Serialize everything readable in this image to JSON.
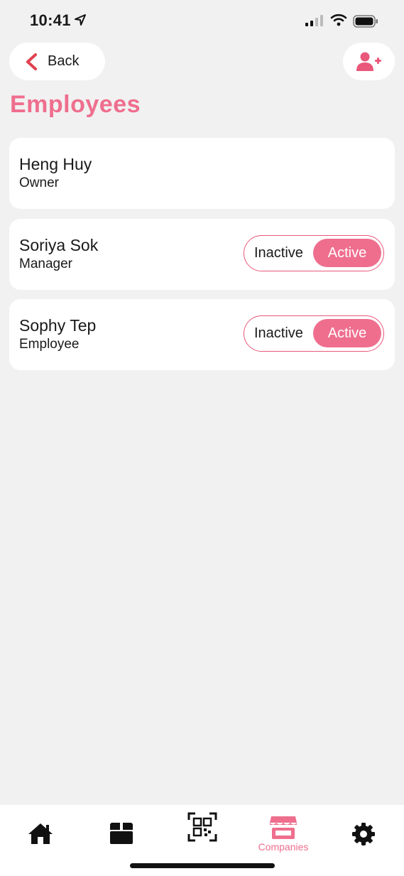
{
  "status_bar": {
    "time": "10:41"
  },
  "header": {
    "back_label": "Back",
    "title": "Employees"
  },
  "employees": [
    {
      "name": "Heng Huy",
      "role": "Owner",
      "show_toggle": false
    },
    {
      "name": "Soriya Sok",
      "role": "Manager",
      "show_toggle": true,
      "inactive_label": "Inactive",
      "active_label": "Active",
      "selected": "Active"
    },
    {
      "name": "Sophy Tep",
      "role": "Employee",
      "show_toggle": true,
      "inactive_label": "Inactive",
      "active_label": "Active",
      "selected": "Active"
    }
  ],
  "tab_bar": {
    "items": [
      {
        "icon": "home-icon",
        "label": ""
      },
      {
        "icon": "box-icon",
        "label": ""
      },
      {
        "icon": "qr-code-icon",
        "label": ""
      },
      {
        "icon": "store-icon",
        "label": "Companies",
        "active": true
      },
      {
        "icon": "gear-icon",
        "label": ""
      }
    ]
  },
  "colors": {
    "accent": "#ef6e8e",
    "back_chevron": "#e0414f",
    "background": "#f1f1f1",
    "card": "#ffffff"
  }
}
